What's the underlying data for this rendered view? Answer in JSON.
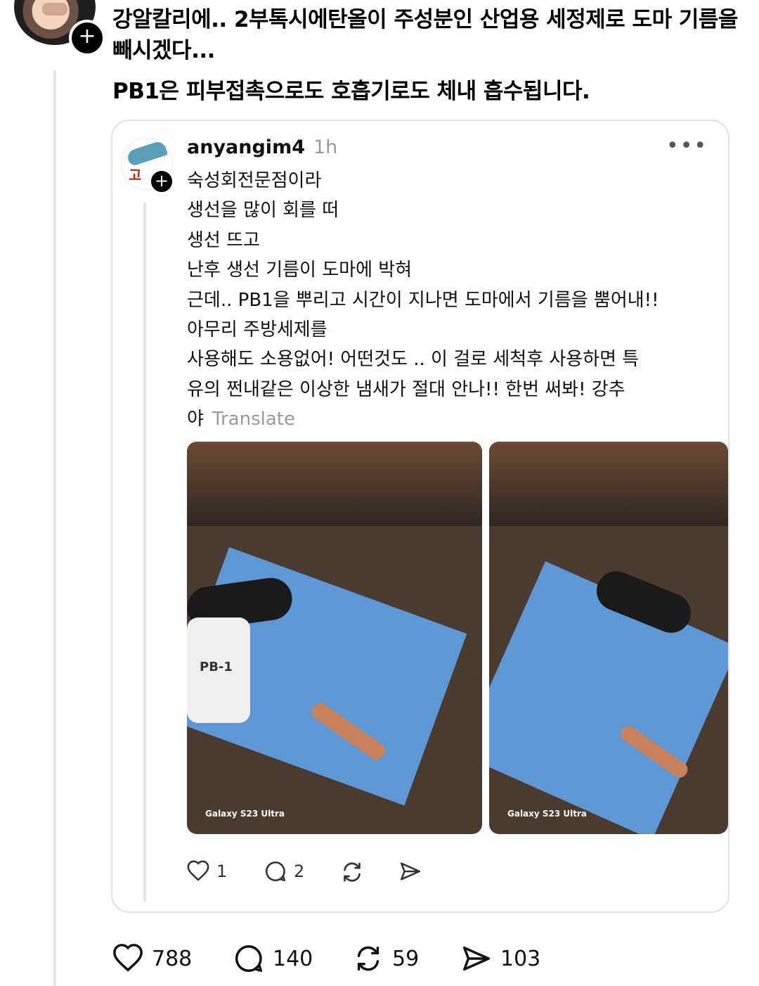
{
  "post": {
    "lines": [
      "강알칼리에.. 2부톡시에탄올이 주성분인 산업용 세정제로 도마 기름을",
      "빼시겠다...",
      "PB1은 피부접촉으로도 호흡기로도 체내 흡수됩니다."
    ]
  },
  "quote": {
    "username": "anyangim4",
    "time": "1h",
    "more": "•••",
    "lines": [
      "숙성회전문점이라",
      "생선을 많이 회를 떠",
      "생선 뜨고",
      "난후 생선 기름이 도마에 박혀",
      "근데.. PB1을 뿌리고 시간이 지나면 도마에서 기름을 뿜어내!!",
      "아무리 주방세제를",
      "사용해도 소용없어! 어떤것도 .. 이 걸로 세척후 사용하면 특",
      "유의 쩐내같은 이상한 냄새가 절대 안나!! 한번 써봐! 강추",
      "야"
    ],
    "translate": "Translate",
    "photo_watermark": "Galaxy S23 Ultra",
    "bottle_label": "PB-1",
    "logo_text": "고",
    "counts": {
      "likes": "1",
      "replies": "2"
    }
  },
  "actions": {
    "likes": "788",
    "replies": "140",
    "reposts": "59",
    "shares": "103"
  },
  "icons": {
    "follow": "plus-icon",
    "like": "heart-icon",
    "reply": "comment-icon",
    "repost": "repost-icon",
    "share": "send-icon"
  },
  "colors": {
    "text": "#000000",
    "muted": "#9b9b9b",
    "border": "#e3e3e3",
    "board": "#5d97d4"
  }
}
